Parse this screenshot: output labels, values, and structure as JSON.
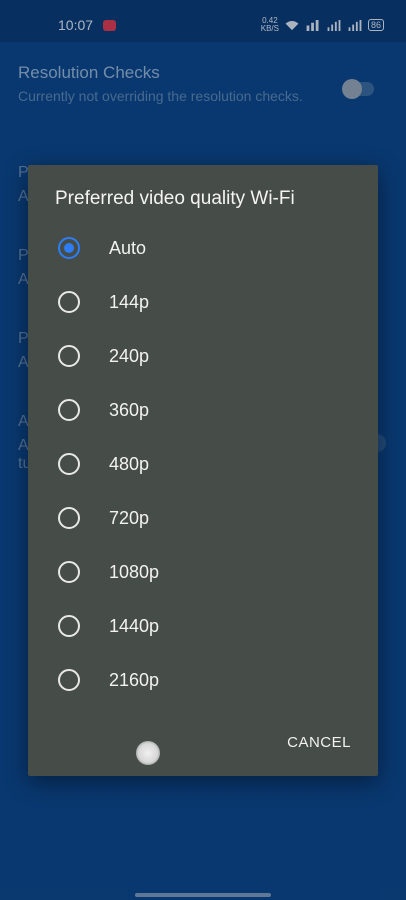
{
  "status_bar": {
    "time": "10:07",
    "net_speed_value": "0.42",
    "net_speed_unit": "KB/S",
    "battery": "86"
  },
  "background": {
    "setting_title": "Resolution Checks",
    "setting_subtitle": "Currently not overriding the resolution checks.",
    "peek_letters": [
      "P",
      "A",
      "P",
      "A",
      "P",
      "A",
      "A",
      "A",
      "tu"
    ]
  },
  "dialog": {
    "title": "Preferred video quality Wi-Fi",
    "options": [
      {
        "label": "Auto",
        "selected": true
      },
      {
        "label": "144p",
        "selected": false
      },
      {
        "label": "240p",
        "selected": false
      },
      {
        "label": "360p",
        "selected": false
      },
      {
        "label": "480p",
        "selected": false
      },
      {
        "label": "720p",
        "selected": false
      },
      {
        "label": "1080p",
        "selected": false
      },
      {
        "label": "1440p",
        "selected": false
      },
      {
        "label": "2160p",
        "selected": false
      }
    ],
    "cancel_label": "CANCEL"
  },
  "colors": {
    "accent": "#2e7df6",
    "dialog_bg": "#464c47",
    "background": "#0d4585"
  }
}
